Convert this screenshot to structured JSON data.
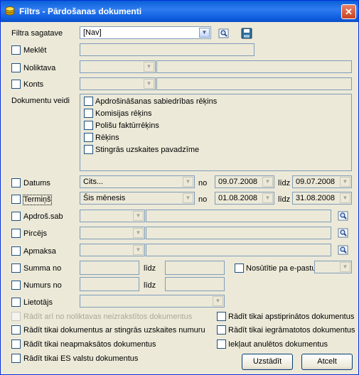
{
  "window": {
    "title": "Filtrs - Pārdošanas dokumenti",
    "close_symbol": "✕"
  },
  "template": {
    "label": "Filtra sagatave",
    "value": "[Nav]"
  },
  "search": {
    "label": "Meklēt",
    "value": ""
  },
  "warehouse": {
    "label": "Noliktava"
  },
  "account": {
    "label": "Konts"
  },
  "doc_types": {
    "label": "Dokumentu veidi",
    "items": [
      "Apdrošināšanas sabiedrības rēķins",
      "Komisijas rēķins",
      "Polišu faktūrrēķins",
      "Rēķins",
      "Stingrās uzskaites pavadzīme"
    ]
  },
  "date": {
    "label": "Datums",
    "period": "Cits...",
    "from_label": "no",
    "from": "09.07.2008",
    "to_label": "līdz",
    "to": "09.07.2008"
  },
  "due": {
    "label": "Termiņš",
    "period": "Šis mēnesis",
    "from_label": "no",
    "from": "01.08.2008",
    "to_label": "līdz",
    "to": "31.08.2008"
  },
  "insurer": {
    "label": "Apdroš.sab"
  },
  "buyer": {
    "label": "Pircējs"
  },
  "payment": {
    "label": "Apmaksa"
  },
  "sum": {
    "label": "Summa no",
    "to_label": "līdz"
  },
  "number": {
    "label": "Numurs no",
    "to_label": "līdz"
  },
  "email": {
    "label": "Nosūtītie pa e-pastu"
  },
  "user": {
    "label": "Lietotājs"
  },
  "options": {
    "show_unregistered": "Rādīt arī no noliktavas neizrakstītos dokumentus",
    "strict_numbered": "Rādīt tikai dokumentus ar stingrās uzskaites numuru",
    "unpaid": "Rādīt tikai neapmaksātos dokumentus",
    "eu_only": "Rādīt tikai ES valstu dokumentus",
    "approved": "Rādīt tikai apstiprinātos dokumentus",
    "booked": "Rādīt tikai iegrāmatotos dokumentus",
    "include_cancelled": "Iekļaut anulētos dokumentus"
  },
  "buttons": {
    "apply": "Uzstādīt",
    "cancel": "Atcelt"
  },
  "icons": {
    "app": "coins-icon",
    "close": "close-icon",
    "lookup": "magnifier-icon",
    "save": "floppy-disk-icon",
    "dropdown": "chevron-down-icon"
  }
}
